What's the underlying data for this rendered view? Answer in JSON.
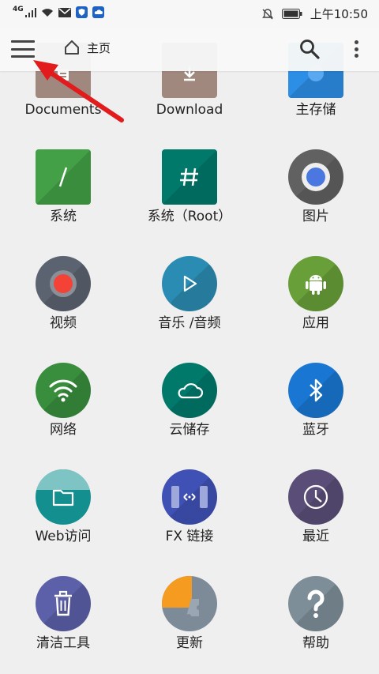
{
  "status": {
    "network": "4G",
    "time": "上午10:50"
  },
  "toolbar": {
    "home_label": "主页"
  },
  "items": [
    {
      "label": "Documents",
      "icon": "documents-folder-icon",
      "color": "#a1887f"
    },
    {
      "label": "Download",
      "icon": "download-folder-icon",
      "color": "#a1887f"
    },
    {
      "label": "主存储",
      "icon": "main-storage-icon",
      "color": "#2d8ee6"
    },
    {
      "label": "系统",
      "icon": "system-icon",
      "color": "#43a047"
    },
    {
      "label": "系统（Root）",
      "icon": "system-root-icon",
      "color": "#00796b"
    },
    {
      "label": "图片",
      "icon": "pictures-icon",
      "color": "#616161"
    },
    {
      "label": "视频",
      "icon": "video-icon",
      "color": "#5c6370"
    },
    {
      "label": "音乐 /音频",
      "icon": "music-icon",
      "color": "#2b8cb3"
    },
    {
      "label": "应用",
      "icon": "android-apps-icon",
      "color": "#689f38"
    },
    {
      "label": "网络",
      "icon": "wifi-network-icon",
      "color": "#388e3c"
    },
    {
      "label": "云储存",
      "icon": "cloud-storage-icon",
      "color": "#00796b"
    },
    {
      "label": "蓝牙",
      "icon": "bluetooth-icon",
      "color": "#1976d2"
    },
    {
      "label": "Web访问",
      "icon": "web-access-icon",
      "color": "#138f8f"
    },
    {
      "label": "FX 链接",
      "icon": "fx-connect-icon",
      "color": "#3f51b5"
    },
    {
      "label": "最近",
      "icon": "recent-clock-icon",
      "color": "#5a4e78"
    },
    {
      "label": "清洁工具",
      "icon": "cleaner-trash-icon",
      "color": "#5b60a8"
    },
    {
      "label": "更新",
      "icon": "update-puzzle-icon",
      "color": "#7d8a97"
    },
    {
      "label": "帮助",
      "icon": "help-icon",
      "color": "#7e8e98"
    }
  ]
}
